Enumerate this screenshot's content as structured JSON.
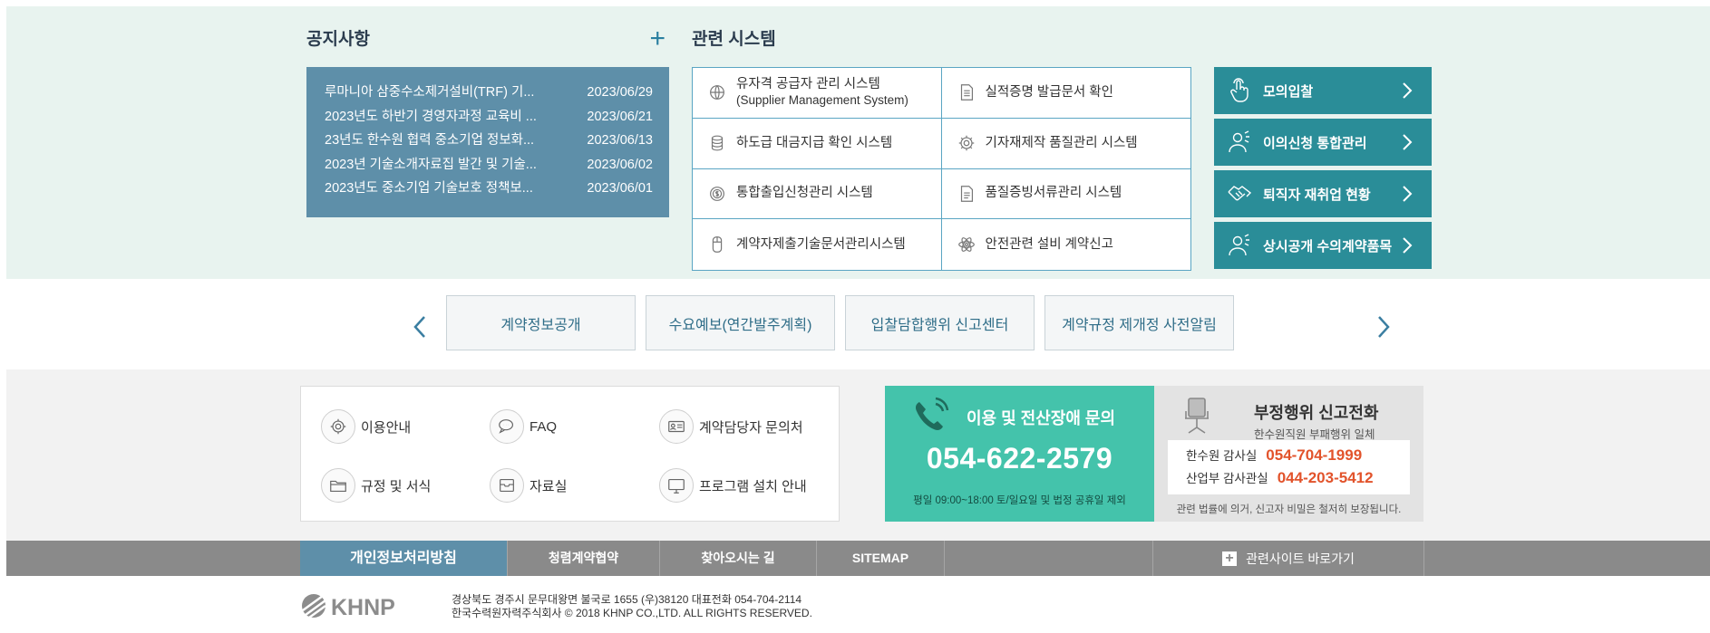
{
  "notice": {
    "title": "공지사항",
    "more": "+",
    "items": [
      {
        "title": "루마니아 삼중수소제거설비(TRF) 기...",
        "date": "2023/06/29"
      },
      {
        "title": "2023년도 하반기 경영자과정 교육비 ...",
        "date": "2023/06/21"
      },
      {
        "title": "23년도 한수원 협력 중소기업 정보화...",
        "date": "2023/06/13"
      },
      {
        "title": "2023년 기술소개자료집 발간 및 기술...",
        "date": "2023/06/02"
      },
      {
        "title": "2023년도 중소기업 기술보호 정책보...",
        "date": "2023/06/01"
      }
    ]
  },
  "related_systems": {
    "title": "관련 시스템",
    "items": [
      {
        "label": "유자격 공급자 관리 시스템",
        "sub": "(Supplier Management System)",
        "icon": "globe-icon"
      },
      {
        "label": "실적증명 발급문서 확인",
        "sub": "",
        "icon": "document-icon"
      },
      {
        "label": "하도급 대금지급 확인 시스템",
        "sub": "",
        "icon": "database-icon"
      },
      {
        "label": "기자재제작 품질관리 시스템",
        "sub": "",
        "icon": "gear-icon"
      },
      {
        "label": "통합출입신청관리 시스템",
        "sub": "",
        "icon": "coin-icon"
      },
      {
        "label": "품질증빙서류관리 시스템",
        "sub": "",
        "icon": "document-icon"
      },
      {
        "label": "계약자제출기술문서관리시스템",
        "sub": "",
        "icon": "mouse-icon"
      },
      {
        "label": "안전관련 설비 계약신고",
        "sub": "",
        "icon": "atom-icon"
      }
    ]
  },
  "quick_buttons": [
    {
      "label": "모의입찰",
      "icon": "hand-pointer-icon"
    },
    {
      "label": "이의신청 통합관리",
      "icon": "person-icon"
    },
    {
      "label": "퇴직자 재취업 현황",
      "icon": "handshake-icon"
    },
    {
      "label": "상시공개 수의계약품목",
      "icon": "person-icon"
    }
  ],
  "carousel": {
    "items": [
      "계약정보공개",
      "수요예보(연간발주계획)",
      "입찰담합행위 신고센터",
      "계약규정 제개정 사전알림"
    ]
  },
  "guide": {
    "items": [
      {
        "label": "이용안내",
        "icon": "gear-icon"
      },
      {
        "label": "FAQ",
        "icon": "chat-icon"
      },
      {
        "label": "계약담당자 문의처",
        "icon": "id-card-icon"
      },
      {
        "label": "규정 및 서식",
        "icon": "folder-icon"
      },
      {
        "label": "자료실",
        "icon": "archive-icon"
      },
      {
        "label": "프로그램 설치 안내",
        "icon": "monitor-icon"
      }
    ]
  },
  "help": {
    "title": "이용 및 전산장애 문의",
    "phone": "054-622-2579",
    "hours": "평일 09:00~18:00 토/일요일 및 법정 공휴일 제외"
  },
  "report": {
    "title": "부정행위 신고전화",
    "sub": "한수원직원 부패행위 일체",
    "lines": [
      {
        "label": "한수원 감사실",
        "phone": "054-704-1999"
      },
      {
        "label": "산업부 감사관실",
        "phone": "044-203-5412"
      }
    ],
    "note": "관련 법률에 의거, 신고자 비밀은 철저히 보장됩니다."
  },
  "footer_nav": {
    "items": [
      "개인정보처리방침",
      "청렴계약협약",
      "찾아오시는 길",
      "SITEMAP"
    ],
    "related_sites": "관련사이트 바로가기"
  },
  "copyright": {
    "logo_text": "KHNP",
    "address": "경상북도 경주시 문무대왕면 불국로 1655 (우)38120 대표전화 054-704-2114",
    "rights": "한국수력원자력주식회사 © 2018 KHNP CO.,LTD. ALL RIGHTS RESERVED."
  },
  "colors": {
    "band_bg": "#e8f3ef",
    "notice_bg": "#5e8fa9",
    "teal_button": "#2a8d98",
    "help_bg": "#44c3ab",
    "report_phone": "#e2532b",
    "footer_bg": "#8a8a8a"
  }
}
